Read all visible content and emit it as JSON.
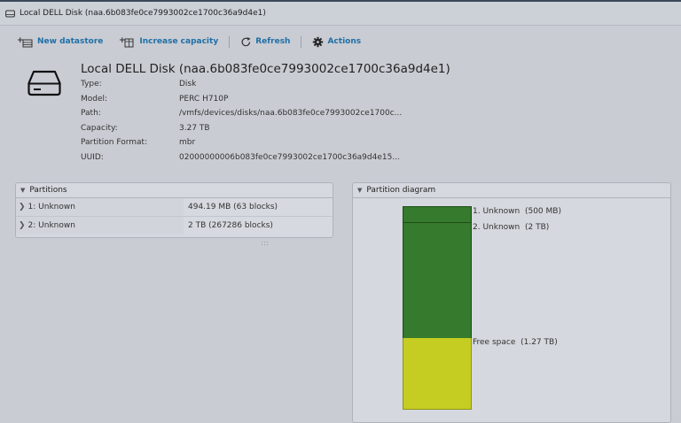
{
  "window": {
    "title": "Local DELL Disk (naa.6b083fe0ce7993002ce1700c36a9d4e1)"
  },
  "toolbar": {
    "new_datastore": "New datastore",
    "increase_capacity": "Increase capacity",
    "refresh": "Refresh",
    "actions": "Actions"
  },
  "summary": {
    "title": "Local DELL Disk (naa.6b083fe0ce7993002ce1700c36a9d4e1)",
    "properties": [
      {
        "key": "Type:",
        "value": "Disk"
      },
      {
        "key": "Model:",
        "value": "PERC H710P"
      },
      {
        "key": "Path:",
        "value": "/vmfs/devices/disks/naa.6b083fe0ce7993002ce1700c..."
      },
      {
        "key": "Capacity:",
        "value": "3.27 TB"
      },
      {
        "key": "Partition Format:",
        "value": "mbr"
      },
      {
        "key": "UUID:",
        "value": "02000000006b083fe0ce7993002ce1700c36a9d4e15..."
      }
    ]
  },
  "partitions": {
    "title": "Partitions",
    "rows": [
      {
        "name": "1: Unknown",
        "size": "494.19 MB (63 blocks)"
      },
      {
        "name": "2: Unknown",
        "size": "2 TB (267286 blocks)"
      }
    ]
  },
  "diagram": {
    "title": "Partition diagram",
    "segments": [
      {
        "label": "1. Unknown",
        "size": "(500 MB)",
        "color": "#367a2d"
      },
      {
        "label": "2. Unknown",
        "size": "(2 TB)",
        "color": "#367a2d"
      },
      {
        "label": "Free space",
        "size": "(1.27 TB)",
        "color": "#c5cd22"
      }
    ]
  }
}
